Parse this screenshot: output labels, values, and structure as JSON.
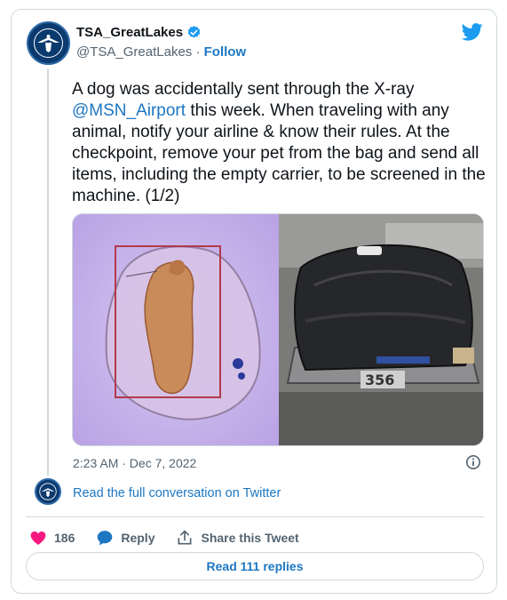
{
  "author": {
    "name": "TSA_GreatLakes",
    "handle": "@TSA_GreatLakes",
    "separator": " · ",
    "follow_label": "Follow",
    "avatar_icon": "tsa-seal-icon",
    "verified_icon": "verified-badge-icon"
  },
  "tweet": {
    "text_part1": "A dog was accidentally sent through the X-ray ",
    "mention": "@MSN_Airport",
    "text_part2": " this week. When traveling with any animal, notify your airline & know their rules. At the checkpoint, remove your pet from the bag and send all items, including the empty carrier, to be screened in the machine. (1/2)",
    "media": [
      {
        "kind": "xray-image",
        "description_icon": "xray-dog-image"
      },
      {
        "kind": "photo",
        "description_icon": "backpack-bin-photo",
        "bin_label": "356"
      }
    ],
    "timestamp": "2:23 AM · Dec 7, 2022"
  },
  "links": {
    "full_conversation": "Read the full conversation on Twitter"
  },
  "actions": {
    "like_count": "186",
    "reply_label": "Reply",
    "share_label": "Share this Tweet"
  },
  "replies_button": "Read 111 replies",
  "colors": {
    "link": "#1d77c3",
    "like": "#f91880",
    "twitter_blue": "#1d9bf0",
    "border": "#cfd9de"
  }
}
